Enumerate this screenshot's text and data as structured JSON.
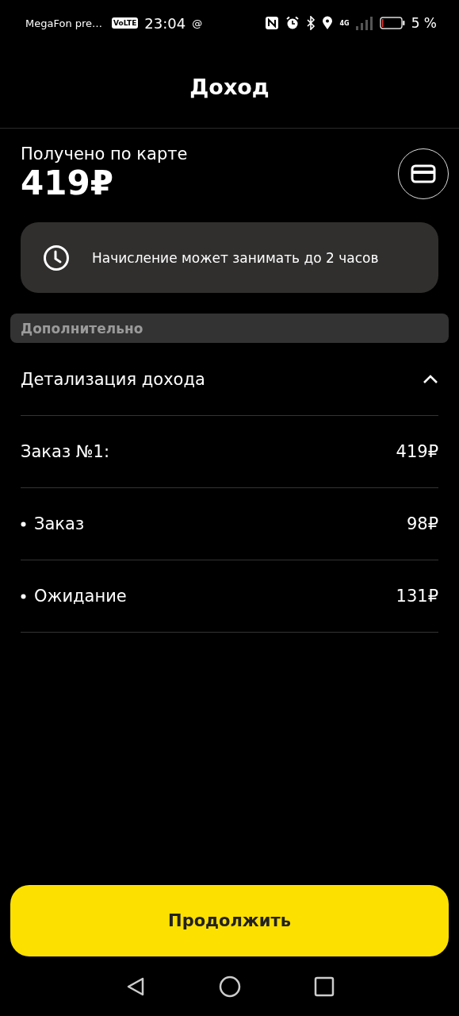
{
  "status_bar": {
    "carrier": "MegaFon pre…",
    "volte": "VoLTE",
    "time": "23:04",
    "at": "@",
    "network": "4G",
    "battery": "5 %"
  },
  "header": {
    "title": "Доход"
  },
  "summary": {
    "label": "Получено по карте",
    "amount": "419₽"
  },
  "notice": {
    "text": "Начисление может занимать до 2 часов"
  },
  "section": {
    "title": "Дополнительно"
  },
  "details": {
    "title": "Детализация дохода",
    "expanded": true,
    "rows": [
      {
        "kind": "total",
        "label": "Заказ №1:",
        "value": "419₽"
      },
      {
        "kind": "item",
        "label": "Заказ",
        "value": "98₽"
      },
      {
        "kind": "item",
        "label": "Ожидание",
        "value": "131₽"
      }
    ]
  },
  "button": {
    "label": "Продолжить"
  }
}
